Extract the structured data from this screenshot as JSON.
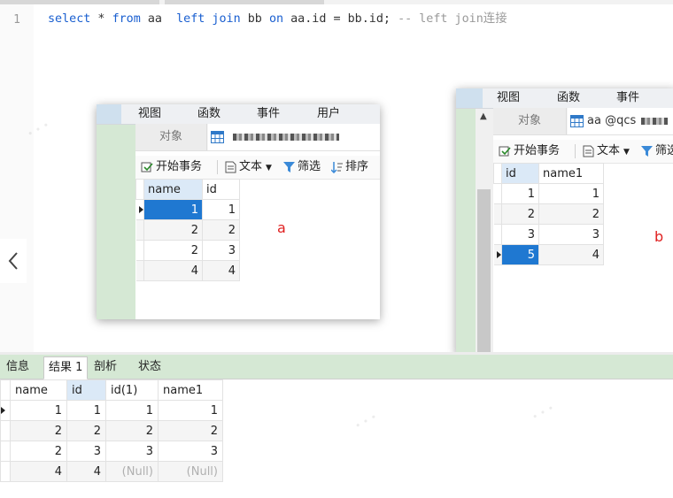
{
  "editor": {
    "line_number": "1",
    "sql": {
      "select": "select",
      "star_from_1": " * ",
      "from": "from",
      "table_a": " aa  ",
      "left_join": "left join",
      "table_b": " bb ",
      "on": "on",
      "condition": " aa.id = bb.id; ",
      "comment": "-- left join连接"
    }
  },
  "window_a": {
    "menu": [
      "视图",
      "函数",
      "事件",
      "用户"
    ],
    "tab_objects": "对象",
    "toolbar": {
      "begin_transaction": "开始事务",
      "text": "文本",
      "filter": "筛选",
      "sort": "排序"
    },
    "columns": [
      "name",
      "id"
    ],
    "rows": [
      [
        "1",
        "1"
      ],
      [
        "2",
        "2"
      ],
      [
        "2",
        "3"
      ],
      [
        "4",
        "4"
      ]
    ],
    "annotation": "a"
  },
  "window_b": {
    "menu": [
      "视图",
      "函数",
      "事件"
    ],
    "tab_objects": "对象",
    "tab_table": "aa @qcs",
    "toolbar": {
      "begin_transaction": "开始事务",
      "text": "文本",
      "filter": "筛选"
    },
    "columns": [
      "id",
      "name1"
    ],
    "rows": [
      [
        "1",
        "1"
      ],
      [
        "2",
        "2"
      ],
      [
        "3",
        "3"
      ],
      [
        "5",
        "4"
      ]
    ],
    "annotation": "b"
  },
  "result_panel": {
    "tabs": [
      "信息",
      "结果 1",
      "剖析",
      "状态"
    ],
    "columns": [
      "name",
      "id",
      "id(1)",
      "name1"
    ],
    "rows": [
      [
        "1",
        "1",
        "1",
        "1"
      ],
      [
        "2",
        "2",
        "2",
        "2"
      ],
      [
        "2",
        "3",
        "3",
        "3"
      ],
      [
        "4",
        "4",
        "(Null)",
        "(Null)"
      ]
    ]
  },
  "colors": {
    "keyword": "#1a5fd0",
    "comment": "#9a9a9a",
    "selection": "#1f78d1",
    "green_bar": "#d5e8d4",
    "header_highlight": "#dbe9f7",
    "annotation": "#e02020"
  }
}
